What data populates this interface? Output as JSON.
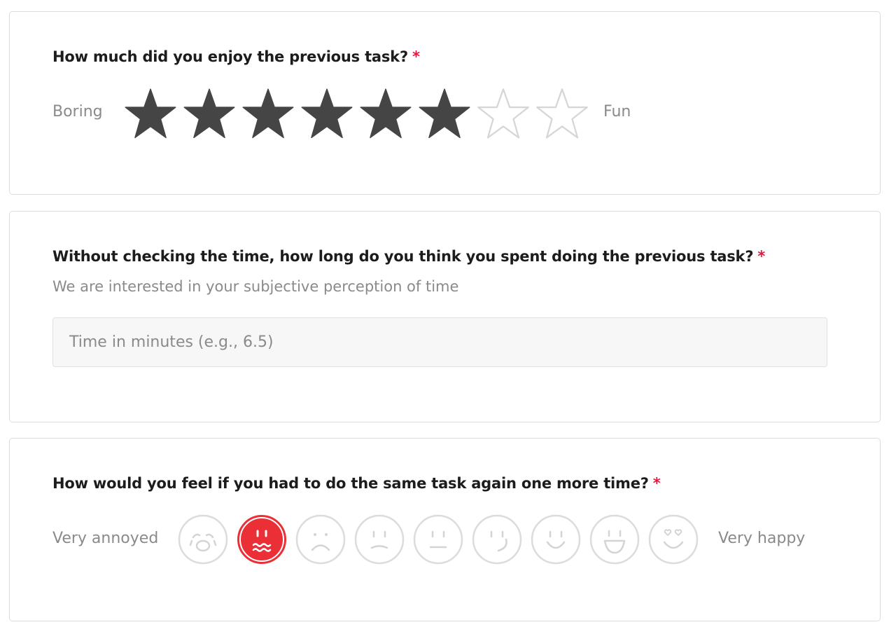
{
  "q1": {
    "question": "How much did you enjoy the previous task?",
    "required_mark": "*",
    "low_label": "Boring",
    "high_label": "Fun",
    "rating": {
      "value": 6,
      "max": 8
    },
    "star_filled_color": "#454545",
    "star_empty_color": "#d6d6d6"
  },
  "q2": {
    "question": "Without checking the time, how long do you think you spent doing the previous task?",
    "required_mark": "*",
    "description": "We are interested in your subjective perception of time",
    "input": {
      "placeholder": "Time in minutes (e.g., 6.5)",
      "value": ""
    }
  },
  "q3": {
    "question": "How would you feel if you had to do the same task again one more time?",
    "required_mark": "*",
    "low_label": "Very annoyed",
    "high_label": "Very happy",
    "selected_index": 1,
    "options": [
      {
        "icon": "crying-face-icon"
      },
      {
        "icon": "nauseated-face-icon"
      },
      {
        "icon": "frowning-face-icon"
      },
      {
        "icon": "slightly-frowning-face-icon"
      },
      {
        "icon": "neutral-face-icon"
      },
      {
        "icon": "smirking-face-icon"
      },
      {
        "icon": "slightly-smiling-face-icon"
      },
      {
        "icon": "grinning-face-icon"
      },
      {
        "icon": "heart-eyes-face-icon"
      }
    ],
    "selected_color": "#ea2f36",
    "outline_color": "#dcdcdc"
  },
  "colors": {
    "required": "#e5173f",
    "muted_text": "#8a8a8a"
  }
}
